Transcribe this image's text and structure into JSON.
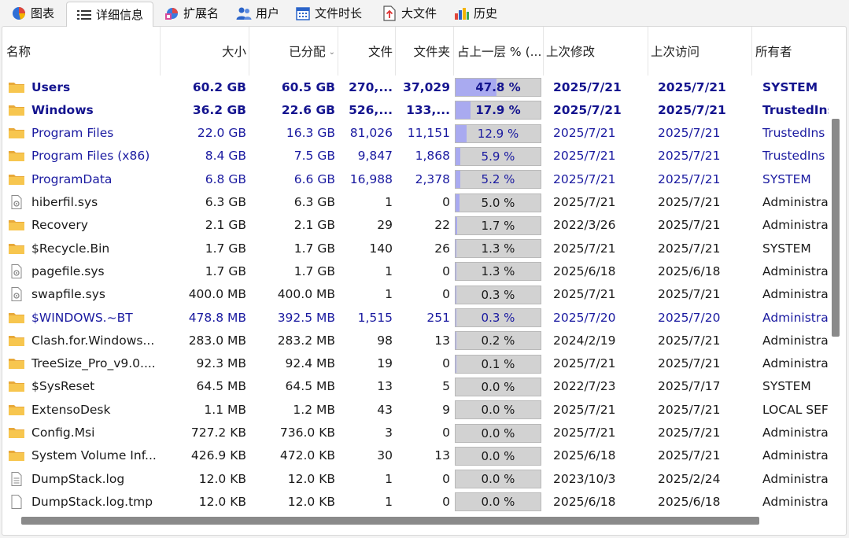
{
  "tabs": [
    {
      "label": "图表",
      "icon": "pie-chart-icon",
      "active": false
    },
    {
      "label": "详细信息",
      "icon": "details-list-icon",
      "active": true
    },
    {
      "label": "扩展名",
      "icon": "extensions-icon",
      "active": false
    },
    {
      "label": "用户",
      "icon": "users-icon",
      "active": false
    },
    {
      "label": "文件时长",
      "icon": "calendar-icon",
      "active": false
    },
    {
      "label": "大文件",
      "icon": "large-file-icon",
      "active": false
    },
    {
      "label": "历史",
      "icon": "history-chart-icon",
      "active": false
    }
  ],
  "columns": {
    "name": "名称",
    "size": "大小",
    "allocated": "已分配",
    "files": "文件",
    "folders": "文件夹",
    "percent": "占上一层 % (...",
    "modified": "上次修改",
    "accessed": "上次访问",
    "owner": "所有者"
  },
  "sort_indicator": "⌄",
  "colors": {
    "bold_text": "#14148f",
    "blue_text": "#1a1aa0",
    "percent_fill": "#a9aaf0",
    "percent_bg": "#d2d2d2",
    "folder": "#f2c14e"
  },
  "rows": [
    {
      "type": "folder",
      "name": "Users",
      "size": "60.2 GB",
      "allocated": "60.5 GB",
      "files": "270,...",
      "folders": "37,029",
      "percent": "47.8 %",
      "pct_value": 47.8,
      "modified": "2025/7/21",
      "accessed": "2025/7/21",
      "owner": "SYSTEM",
      "style": "bold"
    },
    {
      "type": "folder",
      "name": "Windows",
      "size": "36.2 GB",
      "allocated": "22.6 GB",
      "files": "526,...",
      "folders": "133,...",
      "percent": "17.9 %",
      "pct_value": 17.9,
      "modified": "2025/7/21",
      "accessed": "2025/7/21",
      "owner": "TrustedIns",
      "style": "bold"
    },
    {
      "type": "folder",
      "name": "Program Files",
      "size": "22.0 GB",
      "allocated": "16.3 GB",
      "files": "81,026",
      "folders": "11,151",
      "percent": "12.9 %",
      "pct_value": 12.9,
      "modified": "2025/7/21",
      "accessed": "2025/7/21",
      "owner": "TrustedIns",
      "style": "blue"
    },
    {
      "type": "folder",
      "name": "Program Files (x86)",
      "size": "8.4 GB",
      "allocated": "7.5 GB",
      "files": "9,847",
      "folders": "1,868",
      "percent": "5.9 %",
      "pct_value": 5.9,
      "modified": "2025/7/21",
      "accessed": "2025/7/21",
      "owner": "TrustedIns",
      "style": "blue"
    },
    {
      "type": "folder",
      "name": "ProgramData",
      "size": "6.8 GB",
      "allocated": "6.6 GB",
      "files": "16,988",
      "folders": "2,378",
      "percent": "5.2 %",
      "pct_value": 5.2,
      "modified": "2025/7/21",
      "accessed": "2025/7/21",
      "owner": "SYSTEM",
      "style": "blue"
    },
    {
      "type": "sysfile",
      "name": "hiberfil.sys",
      "size": "6.3 GB",
      "allocated": "6.3 GB",
      "files": "1",
      "folders": "0",
      "percent": "5.0 %",
      "pct_value": 5.0,
      "modified": "2025/7/21",
      "accessed": "2025/7/21",
      "owner": "Administra",
      "style": "normal"
    },
    {
      "type": "folder",
      "name": "Recovery",
      "size": "2.1 GB",
      "allocated": "2.1 GB",
      "files": "29",
      "folders": "22",
      "percent": "1.7 %",
      "pct_value": 1.7,
      "modified": "2022/3/26",
      "accessed": "2025/7/21",
      "owner": "Administra",
      "style": "normal"
    },
    {
      "type": "folder",
      "name": "$Recycle.Bin",
      "size": "1.7 GB",
      "allocated": "1.7 GB",
      "files": "140",
      "folders": "26",
      "percent": "1.3 %",
      "pct_value": 1.3,
      "modified": "2025/7/21",
      "accessed": "2025/7/21",
      "owner": "SYSTEM",
      "style": "normal"
    },
    {
      "type": "sysfile",
      "name": "pagefile.sys",
      "size": "1.7 GB",
      "allocated": "1.7 GB",
      "files": "1",
      "folders": "0",
      "percent": "1.3 %",
      "pct_value": 1.3,
      "modified": "2025/6/18",
      "accessed": "2025/6/18",
      "owner": "Administra",
      "style": "normal"
    },
    {
      "type": "sysfile",
      "name": "swapfile.sys",
      "size": "400.0 MB",
      "allocated": "400.0 MB",
      "files": "1",
      "folders": "0",
      "percent": "0.3 %",
      "pct_value": 0.3,
      "modified": "2025/7/21",
      "accessed": "2025/7/21",
      "owner": "Administra",
      "style": "normal"
    },
    {
      "type": "folder",
      "name": "$WINDOWS.~BT",
      "size": "478.8 MB",
      "allocated": "392.5 MB",
      "files": "1,515",
      "folders": "251",
      "percent": "0.3 %",
      "pct_value": 0.3,
      "modified": "2025/7/20",
      "accessed": "2025/7/20",
      "owner": "Administra",
      "style": "blue"
    },
    {
      "type": "folder",
      "name": "Clash.for.Windows...",
      "size": "283.0 MB",
      "allocated": "283.2 MB",
      "files": "98",
      "folders": "13",
      "percent": "0.2 %",
      "pct_value": 0.2,
      "modified": "2024/2/19",
      "accessed": "2025/7/21",
      "owner": "Administra",
      "style": "normal"
    },
    {
      "type": "folder",
      "name": "TreeSize_Pro_v9.0....",
      "size": "92.3 MB",
      "allocated": "92.4 MB",
      "files": "19",
      "folders": "0",
      "percent": "0.1 %",
      "pct_value": 0.1,
      "modified": "2025/7/21",
      "accessed": "2025/7/21",
      "owner": "Administra",
      "style": "normal"
    },
    {
      "type": "folder",
      "name": "$SysReset",
      "size": "64.5 MB",
      "allocated": "64.5 MB",
      "files": "13",
      "folders": "5",
      "percent": "0.0 %",
      "pct_value": 0.0,
      "modified": "2022/7/23",
      "accessed": "2025/7/17",
      "owner": "SYSTEM",
      "style": "normal"
    },
    {
      "type": "folder",
      "name": "ExtensoDesk",
      "size": "1.1 MB",
      "allocated": "1.2 MB",
      "files": "43",
      "folders": "9",
      "percent": "0.0 %",
      "pct_value": 0.0,
      "modified": "2025/7/21",
      "accessed": "2025/7/21",
      "owner": "LOCAL SEF",
      "style": "normal"
    },
    {
      "type": "folder",
      "name": "Config.Msi",
      "size": "727.2 KB",
      "allocated": "736.0 KB",
      "files": "3",
      "folders": "0",
      "percent": "0.0 %",
      "pct_value": 0.0,
      "modified": "2025/7/21",
      "accessed": "2025/7/21",
      "owner": "Administra",
      "style": "normal"
    },
    {
      "type": "folder",
      "name": "System Volume Inf...",
      "size": "426.9 KB",
      "allocated": "472.0 KB",
      "files": "30",
      "folders": "13",
      "percent": "0.0 %",
      "pct_value": 0.0,
      "modified": "2025/6/18",
      "accessed": "2025/7/21",
      "owner": "Administra",
      "style": "normal"
    },
    {
      "type": "textfile",
      "name": "DumpStack.log",
      "size": "12.0 KB",
      "allocated": "12.0 KB",
      "files": "1",
      "folders": "0",
      "percent": "0.0 %",
      "pct_value": 0.0,
      "modified": "2023/10/3",
      "accessed": "2025/2/24",
      "owner": "Administra",
      "style": "normal"
    },
    {
      "type": "blankfile",
      "name": "DumpStack.log.tmp",
      "size": "12.0 KB",
      "allocated": "12.0 KB",
      "files": "1",
      "folders": "0",
      "percent": "0.0 %",
      "pct_value": 0.0,
      "modified": "2025/6/18",
      "accessed": "2025/6/18",
      "owner": "Administra",
      "style": "normal"
    }
  ]
}
